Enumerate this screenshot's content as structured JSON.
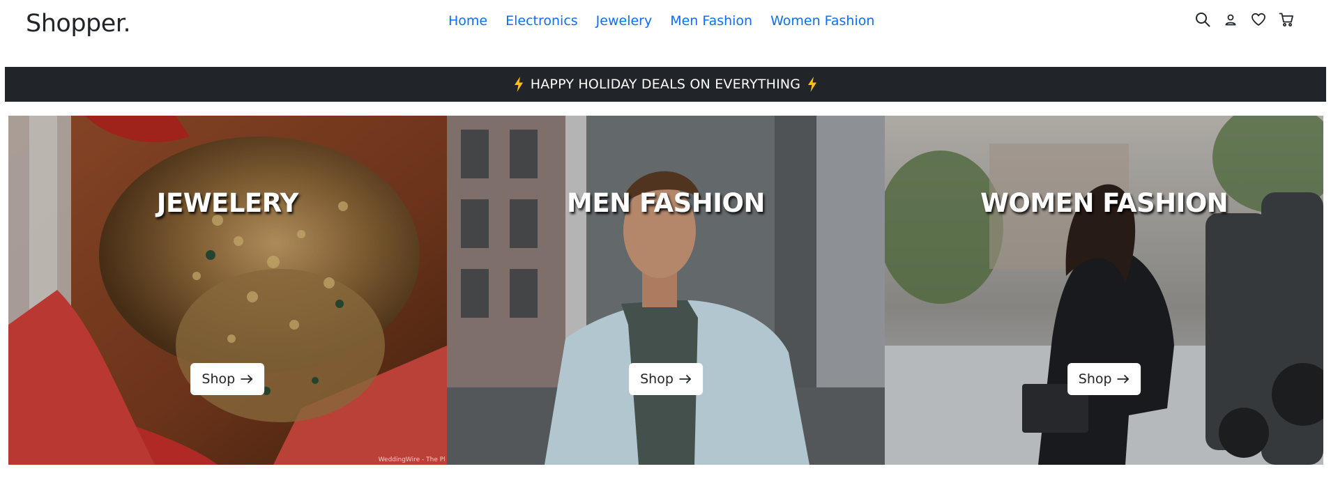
{
  "brand": "Shopper.",
  "nav": {
    "links": [
      {
        "label": "Home"
      },
      {
        "label": "Electronics"
      },
      {
        "label": "Jewelery"
      },
      {
        "label": "Men Fashion"
      },
      {
        "label": "Women Fashion"
      }
    ],
    "icons": [
      "search-icon",
      "user-icon",
      "heart-icon",
      "cart-icon"
    ]
  },
  "promo": {
    "text": "HAPPY HOLIDAY DEALS ON EVERYTHING",
    "bolt_color": "#ffc107",
    "background": "#212529"
  },
  "categories": [
    {
      "title": "JEWELERY",
      "button_label": "Shop",
      "image_caption": "WeddingWire - The Pl"
    },
    {
      "title": "MEN FASHION",
      "button_label": "Shop"
    },
    {
      "title": "WOMEN FASHION",
      "button_label": "Shop"
    }
  ],
  "colors": {
    "link": "#0d6efd",
    "text_dark": "#212529"
  }
}
